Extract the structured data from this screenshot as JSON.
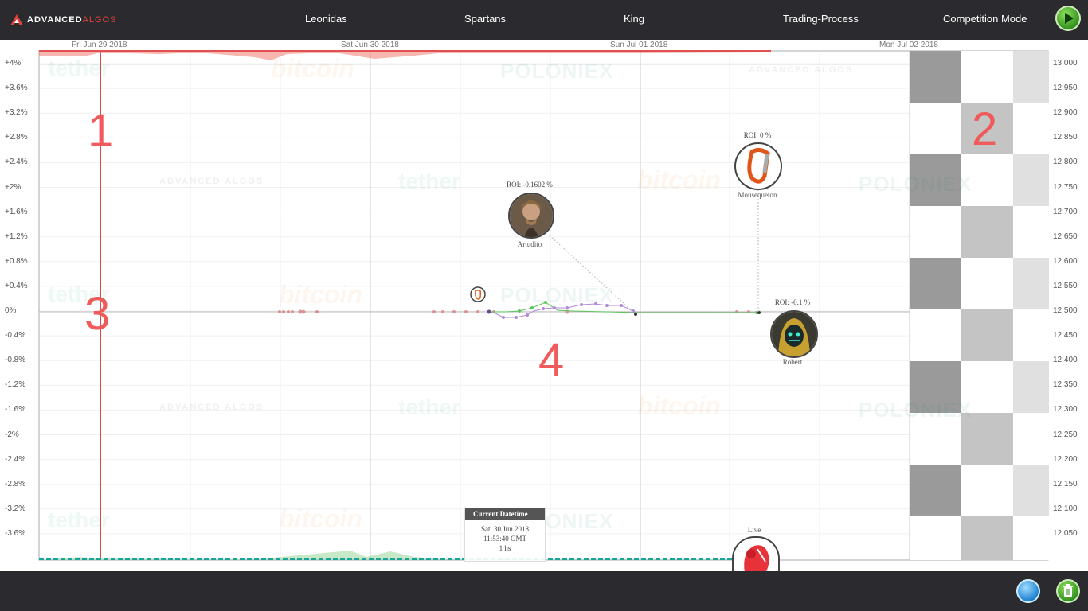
{
  "brand": {
    "part1": "ADVANCED",
    "part2": "ALGOS"
  },
  "nav": {
    "items": [
      {
        "label": "Leonidas"
      },
      {
        "label": "Spartans"
      },
      {
        "label": "King"
      },
      {
        "label": "Trading-Process"
      },
      {
        "label": "Competition Mode"
      }
    ]
  },
  "chart": {
    "dates": [
      "Fri Jun 29 2018",
      "Sat Jun 30 2018",
      "Sun Jul 01 2018",
      "Mon Jul 02 2018"
    ],
    "left_axis": [
      "+4%",
      "+3.6%",
      "+3.2%",
      "+2.8%",
      "+2.4%",
      "+2%",
      "+1.6%",
      "+1.2%",
      "+0.8%",
      "+0.4%",
      "0%",
      "-0.4%",
      "-0.8%",
      "-1.2%",
      "-1.6%",
      "-2%",
      "-2.4%",
      "-2.8%",
      "-3.2%",
      "-3.6%"
    ],
    "right_axis": [
      "13,000",
      "12,950",
      "12,900",
      "12,850",
      "12,800",
      "12,750",
      "12,700",
      "12,650",
      "12,600",
      "12,550",
      "12,500",
      "12,450",
      "12,400",
      "12,350",
      "12,300",
      "12,250",
      "12,200",
      "12,150",
      "12,100",
      "12,050"
    ],
    "annotations": [
      "1",
      "2",
      "3",
      "4"
    ],
    "watermarks": {
      "tether": "tether",
      "bitcoin": "bitcoin",
      "poloniex": "POLONIEX",
      "aa": "ADVANCED ALGOS"
    }
  },
  "competitors": {
    "artudito": {
      "roi": "ROI: -0.1602 %",
      "name": "Artudito"
    },
    "mousequeton": {
      "roi": "ROI: 0 %",
      "name": "Mousequeton"
    },
    "robert": {
      "roi": "ROI: -0.1 %",
      "name": "Robert"
    },
    "live": {
      "name": "Live"
    }
  },
  "datetime_panel": {
    "title": "Current Datetime",
    "date": "Sat, 30 Jun 2018",
    "time": "11:53:40 GMT",
    "duration": "1 hs"
  },
  "colors": {
    "accent": "#e0413c",
    "topbar": "#2b2b2f",
    "series_green": "#5cc45c",
    "series_purple": "#b08ad8"
  }
}
